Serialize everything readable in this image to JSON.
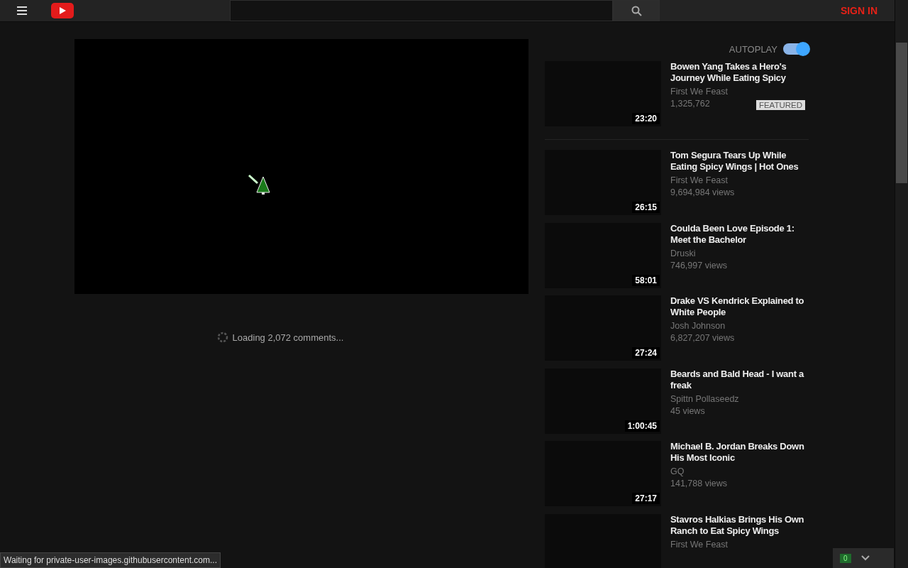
{
  "header": {
    "sign_in": "SIGN IN"
  },
  "autoplay": {
    "label": "AUTOPLAY",
    "on": true
  },
  "comments": {
    "loading": "Loading 2,072 comments..."
  },
  "videos": [
    {
      "title": "Bowen Yang Takes a Hero's Journey While Eating Spicy",
      "channel": "First We Feast",
      "views": "1,325,762",
      "duration": "23:20",
      "badge": "FEATURED"
    },
    {
      "title": "Tom Segura Tears Up While Eating Spicy Wings | Hot Ones",
      "channel": "First We Feast",
      "views": "9,694,984 views",
      "duration": "26:15"
    },
    {
      "title": "Coulda Been Love Episode 1: Meet the Bachelor",
      "channel": "Druski",
      "views": "746,997 views",
      "duration": "58:01"
    },
    {
      "title": "Drake VS Kendrick Explained to White People",
      "channel": "Josh Johnson",
      "views": "6,827,207 views",
      "duration": "27:24"
    },
    {
      "title": "Beards and Bald Head - I want a freak",
      "channel": "Spittn Pollaseedz",
      "views": "45 views",
      "duration": "1:00:45"
    },
    {
      "title": "Michael B. Jordan Breaks Down His Most Iconic",
      "channel": "GQ",
      "views": "141,788 views",
      "duration": "27:17"
    },
    {
      "title": "Stavros Halkias Brings His Own Ranch to Eat Spicy Wings",
      "channel": "First We Feast"
    }
  ],
  "status": {
    "text": "Waiting for private-user-images.githubusercontent.com..."
  },
  "widget": {
    "count": "0"
  }
}
